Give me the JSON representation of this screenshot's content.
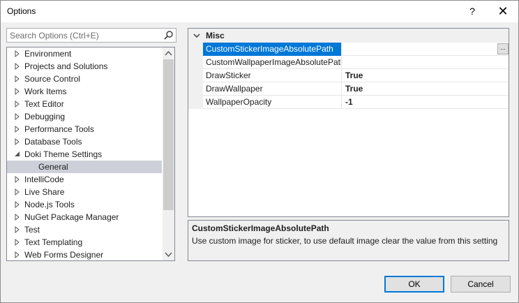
{
  "window": {
    "title": "Options",
    "help": "?",
    "close": "✕"
  },
  "search": {
    "placeholder": "Search Options (Ctrl+E)"
  },
  "tree": {
    "items": [
      {
        "label": "Environment"
      },
      {
        "label": "Projects and Solutions"
      },
      {
        "label": "Source Control"
      },
      {
        "label": "Work Items"
      },
      {
        "label": "Text Editor"
      },
      {
        "label": "Debugging"
      },
      {
        "label": "Performance Tools"
      },
      {
        "label": "Database Tools"
      },
      {
        "label": "Doki Theme Settings"
      },
      {
        "label": "General"
      },
      {
        "label": "IntelliCode"
      },
      {
        "label": "Live Share"
      },
      {
        "label": "Node.js Tools"
      },
      {
        "label": "NuGet Package Manager"
      },
      {
        "label": "Test"
      },
      {
        "label": "Text Templating"
      },
      {
        "label": "Web Forms Designer"
      }
    ]
  },
  "grid": {
    "category": "Misc",
    "properties": [
      {
        "name": "CustomStickerImageAbsolutePath",
        "value": ""
      },
      {
        "name": "CustomWallpaperImageAbsolutePath",
        "value": ""
      },
      {
        "name": "DrawSticker",
        "value": "True"
      },
      {
        "name": "DrawWallpaper",
        "value": "True"
      },
      {
        "name": "WallpaperOpacity",
        "value": "-1"
      }
    ],
    "ellipsis": "..."
  },
  "description": {
    "title": "CustomStickerImageAbsolutePath",
    "text": "Use custom image for sticker, to use default image clear the value from this setting"
  },
  "buttons": {
    "ok": "OK",
    "cancel": "Cancel"
  },
  "colors": {
    "accent": "#0078d7",
    "tree_selected": "#cdd0d8"
  }
}
